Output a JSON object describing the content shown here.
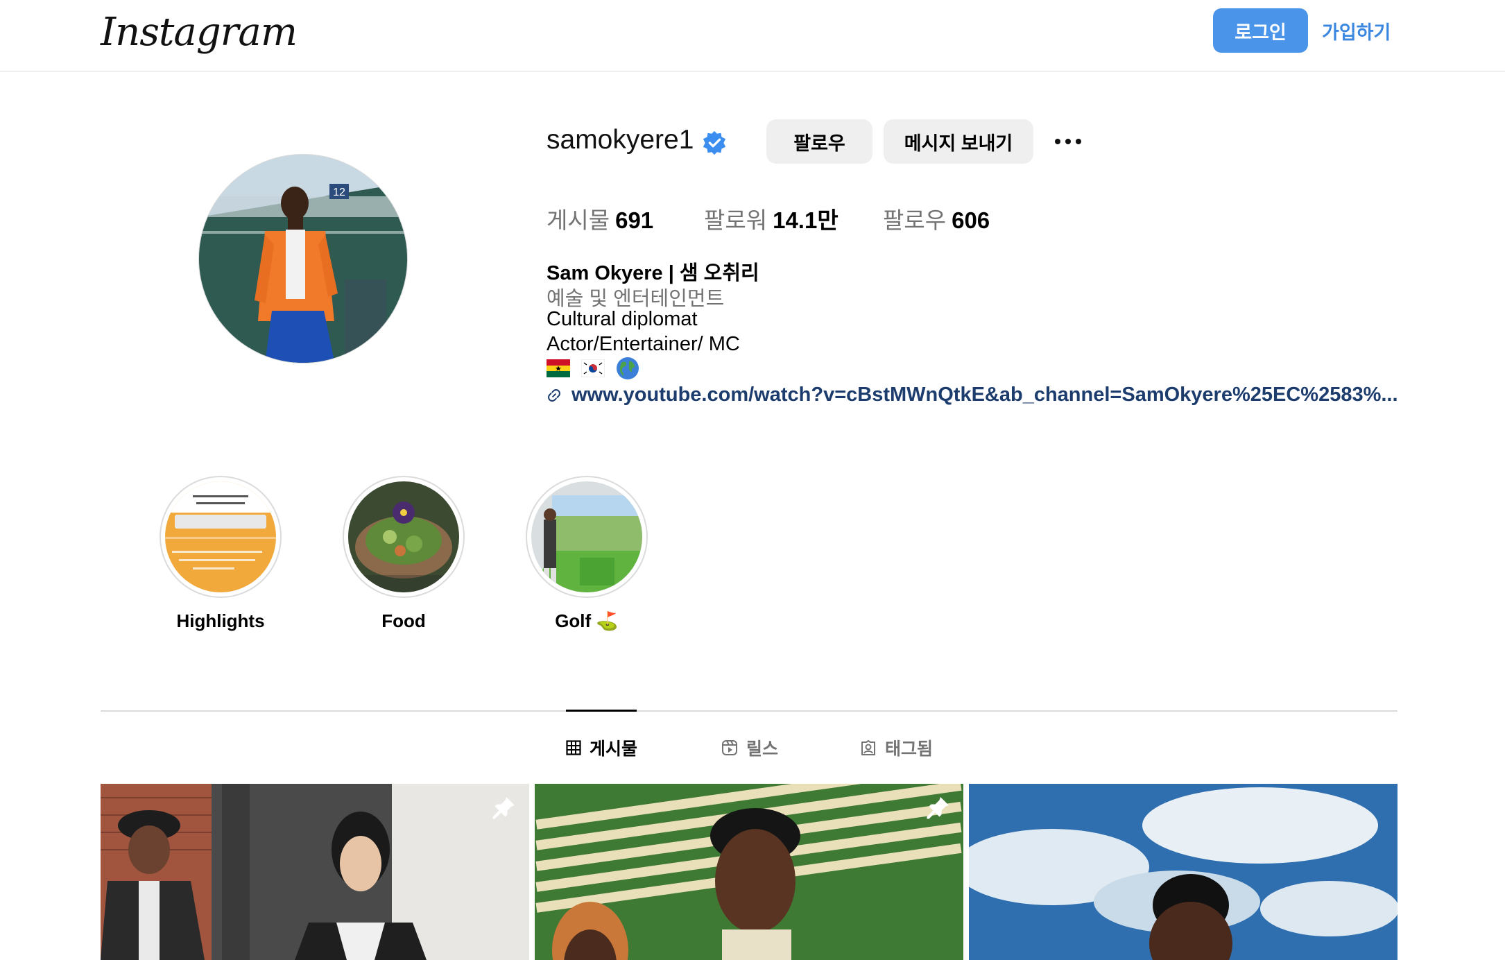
{
  "header": {
    "logo_text": "Instagram",
    "login_label": "로그인",
    "signup_label": "가입하기",
    "accent_color": "#4a95ea"
  },
  "profile": {
    "username": "samokyere1",
    "verified": true,
    "follow_label": "팔로우",
    "message_label": "메시지 보내기",
    "stats": [
      {
        "label": "게시물",
        "value": "691"
      },
      {
        "label": "팔로워",
        "value": "14.1만"
      },
      {
        "label": "팔로우",
        "value": "606"
      }
    ],
    "bio": {
      "name": "Sam Okyere | 샘 오취리",
      "category": "예술 및 엔터테인먼트",
      "lines": [
        "Cultural diplomat",
        "Actor/Entertainer/ MC"
      ],
      "flags": [
        "ghana-flag",
        "south-korea-flag",
        "globe-icon"
      ],
      "link": "www.youtube.com/watch?v=cBstMWnQtkE&ab_channel=SamOkyere%25EC%2583%..."
    }
  },
  "highlights": [
    {
      "label": "Highlights"
    },
    {
      "label": "Food"
    },
    {
      "label": "Golf ⛳"
    }
  ],
  "tabs": [
    {
      "label": "게시물",
      "icon": "grid-icon",
      "active": true
    },
    {
      "label": "릴스",
      "icon": "reels-icon",
      "active": false
    },
    {
      "label": "태그됨",
      "icon": "tagged-icon",
      "active": false
    }
  ],
  "posts": [
    {
      "pinned": true
    },
    {
      "pinned": true
    },
    {
      "pinned": false
    }
  ]
}
